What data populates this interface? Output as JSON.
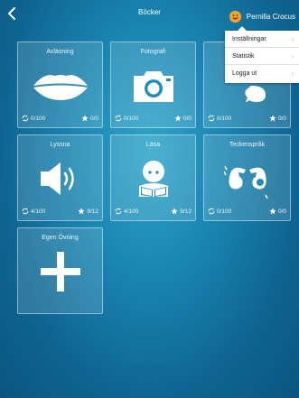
{
  "header": {
    "title": "Böcker",
    "user_name": "Pernilla Crocus"
  },
  "menu": {
    "items": [
      {
        "label": "Inställningar"
      },
      {
        "label": "Statistik"
      },
      {
        "label": "Logga ut"
      }
    ],
    "chevron": "›"
  },
  "tiles": [
    {
      "label": "Avläsning",
      "icon": "lips-icon",
      "progress": "0/100",
      "stars": "0/0"
    },
    {
      "label": "Fotografi",
      "icon": "camera-icon",
      "progress": "0/100",
      "stars": "0/0"
    },
    {
      "label": "",
      "icon": "speech-icon",
      "progress": "0/100",
      "stars": "0/0"
    },
    {
      "label": "Lyssna",
      "icon": "speaker-icon",
      "progress": "4/100",
      "stars": "9/12"
    },
    {
      "label": "Läsa",
      "icon": "reading-child-icon",
      "progress": "4/100",
      "stars": "9/12"
    },
    {
      "label": "Teckenspråk",
      "icon": "sign-language-icon",
      "progress": "0/100",
      "stars": "0/0"
    },
    {
      "label": "Egen Övning",
      "icon": "plus-icon"
    }
  ]
}
